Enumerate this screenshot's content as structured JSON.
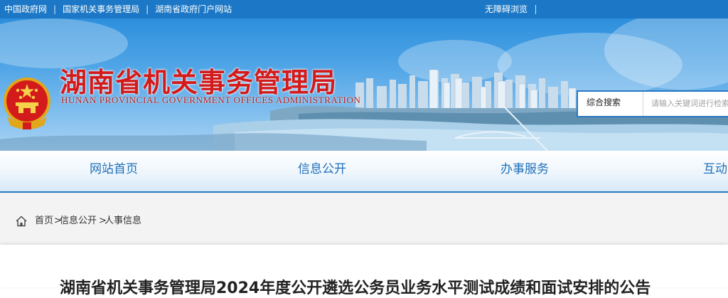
{
  "topbar": {
    "links": [
      "中国政府网",
      "国家机关事务管理局",
      "湖南省政府门户网站"
    ],
    "separator": "|",
    "accessibility": "无障碍浏览"
  },
  "banner": {
    "title": "湖南省机关事务管理局",
    "subtitle": "HUNAN PROVINCIAL GOVERNMENT OFFICES ADMINISTRATION",
    "emblem_icon": "national-emblem-icon"
  },
  "search": {
    "scope": "综合搜索",
    "placeholder": "请输入关键词进行检索"
  },
  "nav": {
    "items": [
      "网站首页",
      "信息公开",
      "办事服务",
      "互动"
    ]
  },
  "breadcrumb": {
    "items": [
      "首页",
      "信息公开",
      "人事信息"
    ],
    "separator": ">"
  },
  "article": {
    "title": "湖南省机关事务管理局2024年度公开遴选公务员业务水平测试成绩和面试安排的公告"
  },
  "colors": {
    "topbar": "#1c78c6",
    "title_red": "#d31b1b",
    "nav_text": "#1f6fb8",
    "accent_line": "#2a78c4"
  }
}
